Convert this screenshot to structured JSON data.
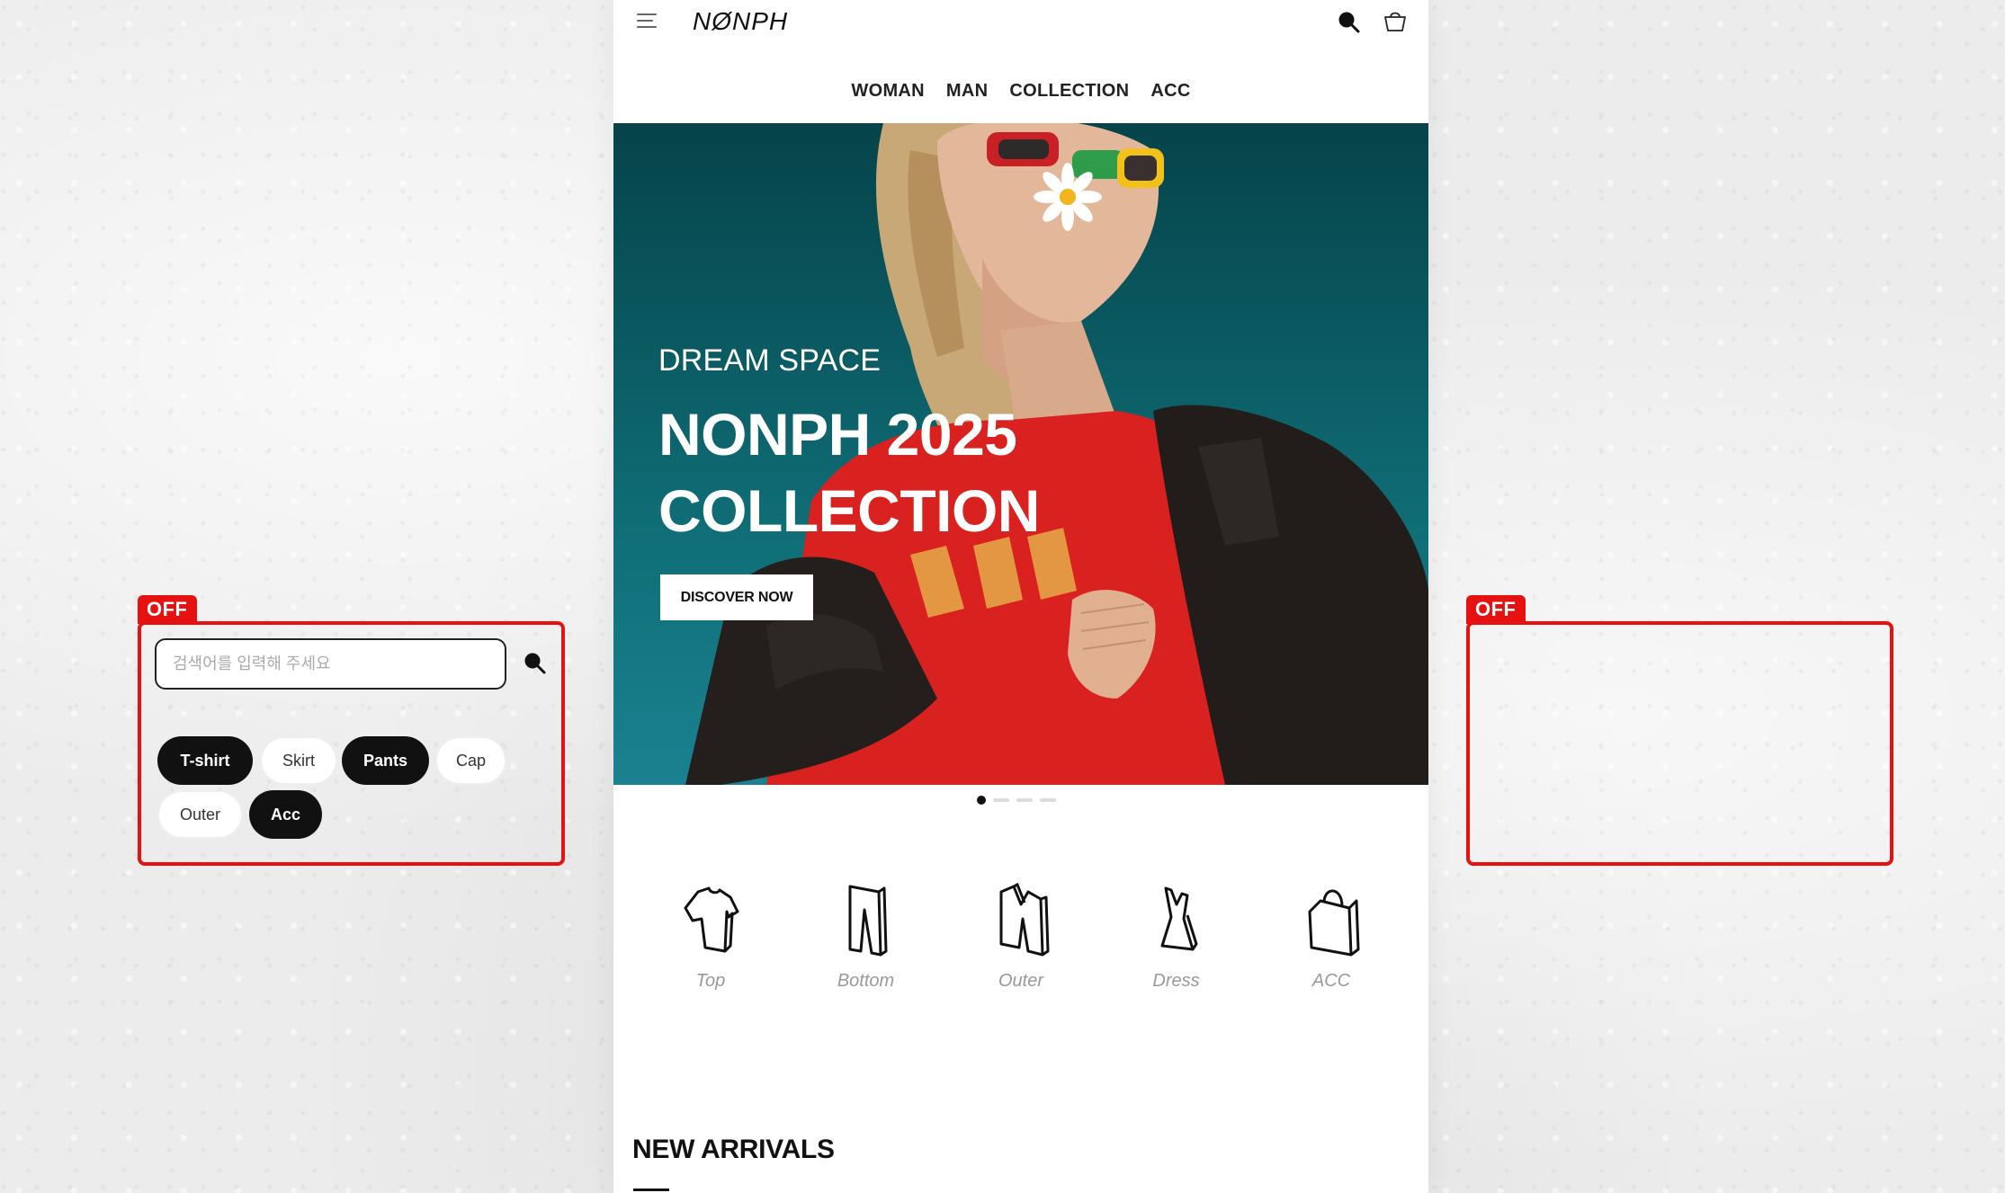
{
  "brand": {
    "logo": "NØNPH"
  },
  "nav": [
    "WOMAN",
    "MAN",
    "COLLECTION",
    "ACC"
  ],
  "hero": {
    "subtitle": "DREAM SPACE",
    "title_line1": "NONPH 2025",
    "title_line2": "COLLECTION",
    "button": "DISCOVER NOW"
  },
  "slider": {
    "total": 4,
    "active": 1
  },
  "categories": [
    "Top",
    "Bottom",
    "Outer",
    "Dress",
    "ACC"
  ],
  "section": {
    "new_arrivals": "NEW ARRIVALS"
  },
  "left_panel": {
    "tag": "OFF",
    "search_placeholder": "검색어를 입력해 주세요",
    "chips": [
      {
        "label": "T-shirt",
        "active": true
      },
      {
        "label": "Skirt",
        "active": false
      },
      {
        "label": "Pants",
        "active": true
      },
      {
        "label": "Cap",
        "active": false
      },
      {
        "label": "Outer",
        "active": false
      },
      {
        "label": "Acc",
        "active": true
      }
    ]
  },
  "right_panel": {
    "tag": "OFF"
  },
  "colors": {
    "accent": "#e61212",
    "hero_bg": "#0b5b63",
    "chip_active": "#111111"
  }
}
